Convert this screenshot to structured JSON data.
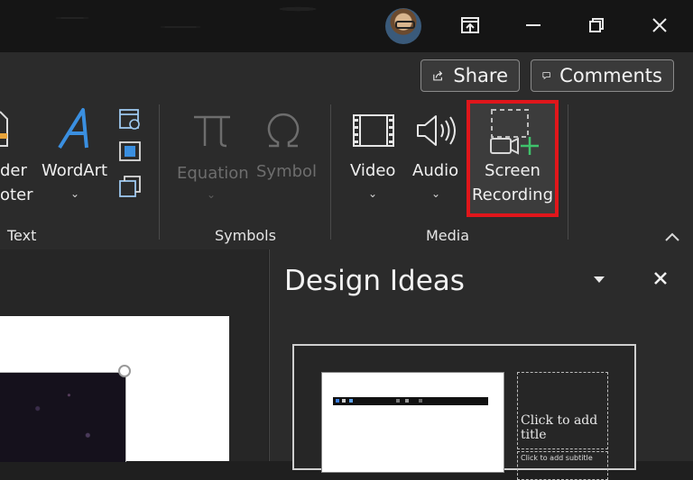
{
  "window": {
    "buttons": [
      "restore-to-window",
      "minimize",
      "restore",
      "close"
    ]
  },
  "ribbon": {
    "share_label": "Share",
    "comments_label": "Comments",
    "text_group": {
      "header_footer_line1": "der",
      "header_footer_line2": "oter",
      "wordart_label": "WordArt",
      "group_label": "Text"
    },
    "symbols_group": {
      "equation_label": "Equation",
      "symbol_label": "Symbol",
      "group_label": "Symbols"
    },
    "media_group": {
      "video_label": "Video",
      "audio_label": "Audio",
      "screen_recording_line1": "Screen",
      "screen_recording_line2": "Recording",
      "group_label": "Media"
    },
    "highlight_color": "#e0161b"
  },
  "design_pane": {
    "title": "Design Ideas",
    "thumbnail_title_placeholder": "Click to add title",
    "thumbnail_subtitle_placeholder": "Click to add subtitle"
  }
}
